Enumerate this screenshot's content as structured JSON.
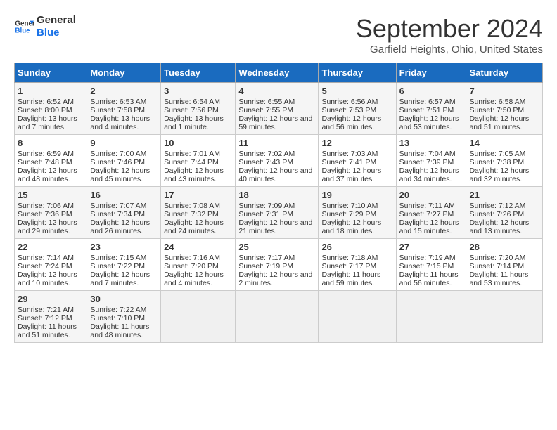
{
  "logo": {
    "line1": "General",
    "line2": "Blue"
  },
  "title": "September 2024",
  "subtitle": "Garfield Heights, Ohio, United States",
  "days_of_week": [
    "Sunday",
    "Monday",
    "Tuesday",
    "Wednesday",
    "Thursday",
    "Friday",
    "Saturday"
  ],
  "weeks": [
    [
      {
        "day": "1",
        "sunrise": "6:52 AM",
        "sunset": "8:00 PM",
        "daylight": "13 hours and 7 minutes."
      },
      {
        "day": "2",
        "sunrise": "6:53 AM",
        "sunset": "7:58 PM",
        "daylight": "13 hours and 4 minutes."
      },
      {
        "day": "3",
        "sunrise": "6:54 AM",
        "sunset": "7:56 PM",
        "daylight": "13 hours and 1 minute."
      },
      {
        "day": "4",
        "sunrise": "6:55 AM",
        "sunset": "7:55 PM",
        "daylight": "12 hours and 59 minutes."
      },
      {
        "day": "5",
        "sunrise": "6:56 AM",
        "sunset": "7:53 PM",
        "daylight": "12 hours and 56 minutes."
      },
      {
        "day": "6",
        "sunrise": "6:57 AM",
        "sunset": "7:51 PM",
        "daylight": "12 hours and 53 minutes."
      },
      {
        "day": "7",
        "sunrise": "6:58 AM",
        "sunset": "7:50 PM",
        "daylight": "12 hours and 51 minutes."
      }
    ],
    [
      {
        "day": "8",
        "sunrise": "6:59 AM",
        "sunset": "7:48 PM",
        "daylight": "12 hours and 48 minutes."
      },
      {
        "day": "9",
        "sunrise": "7:00 AM",
        "sunset": "7:46 PM",
        "daylight": "12 hours and 45 minutes."
      },
      {
        "day": "10",
        "sunrise": "7:01 AM",
        "sunset": "7:44 PM",
        "daylight": "12 hours and 43 minutes."
      },
      {
        "day": "11",
        "sunrise": "7:02 AM",
        "sunset": "7:43 PM",
        "daylight": "12 hours and 40 minutes."
      },
      {
        "day": "12",
        "sunrise": "7:03 AM",
        "sunset": "7:41 PM",
        "daylight": "12 hours and 37 minutes."
      },
      {
        "day": "13",
        "sunrise": "7:04 AM",
        "sunset": "7:39 PM",
        "daylight": "12 hours and 34 minutes."
      },
      {
        "day": "14",
        "sunrise": "7:05 AM",
        "sunset": "7:38 PM",
        "daylight": "12 hours and 32 minutes."
      }
    ],
    [
      {
        "day": "15",
        "sunrise": "7:06 AM",
        "sunset": "7:36 PM",
        "daylight": "12 hours and 29 minutes."
      },
      {
        "day": "16",
        "sunrise": "7:07 AM",
        "sunset": "7:34 PM",
        "daylight": "12 hours and 26 minutes."
      },
      {
        "day": "17",
        "sunrise": "7:08 AM",
        "sunset": "7:32 PM",
        "daylight": "12 hours and 24 minutes."
      },
      {
        "day": "18",
        "sunrise": "7:09 AM",
        "sunset": "7:31 PM",
        "daylight": "12 hours and 21 minutes."
      },
      {
        "day": "19",
        "sunrise": "7:10 AM",
        "sunset": "7:29 PM",
        "daylight": "12 hours and 18 minutes."
      },
      {
        "day": "20",
        "sunrise": "7:11 AM",
        "sunset": "7:27 PM",
        "daylight": "12 hours and 15 minutes."
      },
      {
        "day": "21",
        "sunrise": "7:12 AM",
        "sunset": "7:26 PM",
        "daylight": "12 hours and 13 minutes."
      }
    ],
    [
      {
        "day": "22",
        "sunrise": "7:14 AM",
        "sunset": "7:24 PM",
        "daylight": "12 hours and 10 minutes."
      },
      {
        "day": "23",
        "sunrise": "7:15 AM",
        "sunset": "7:22 PM",
        "daylight": "12 hours and 7 minutes."
      },
      {
        "day": "24",
        "sunrise": "7:16 AM",
        "sunset": "7:20 PM",
        "daylight": "12 hours and 4 minutes."
      },
      {
        "day": "25",
        "sunrise": "7:17 AM",
        "sunset": "7:19 PM",
        "daylight": "12 hours and 2 minutes."
      },
      {
        "day": "26",
        "sunrise": "7:18 AM",
        "sunset": "7:17 PM",
        "daylight": "11 hours and 59 minutes."
      },
      {
        "day": "27",
        "sunrise": "7:19 AM",
        "sunset": "7:15 PM",
        "daylight": "11 hours and 56 minutes."
      },
      {
        "day": "28",
        "sunrise": "7:20 AM",
        "sunset": "7:14 PM",
        "daylight": "11 hours and 53 minutes."
      }
    ],
    [
      {
        "day": "29",
        "sunrise": "7:21 AM",
        "sunset": "7:12 PM",
        "daylight": "11 hours and 51 minutes."
      },
      {
        "day": "30",
        "sunrise": "7:22 AM",
        "sunset": "7:10 PM",
        "daylight": "11 hours and 48 minutes."
      },
      null,
      null,
      null,
      null,
      null
    ]
  ]
}
